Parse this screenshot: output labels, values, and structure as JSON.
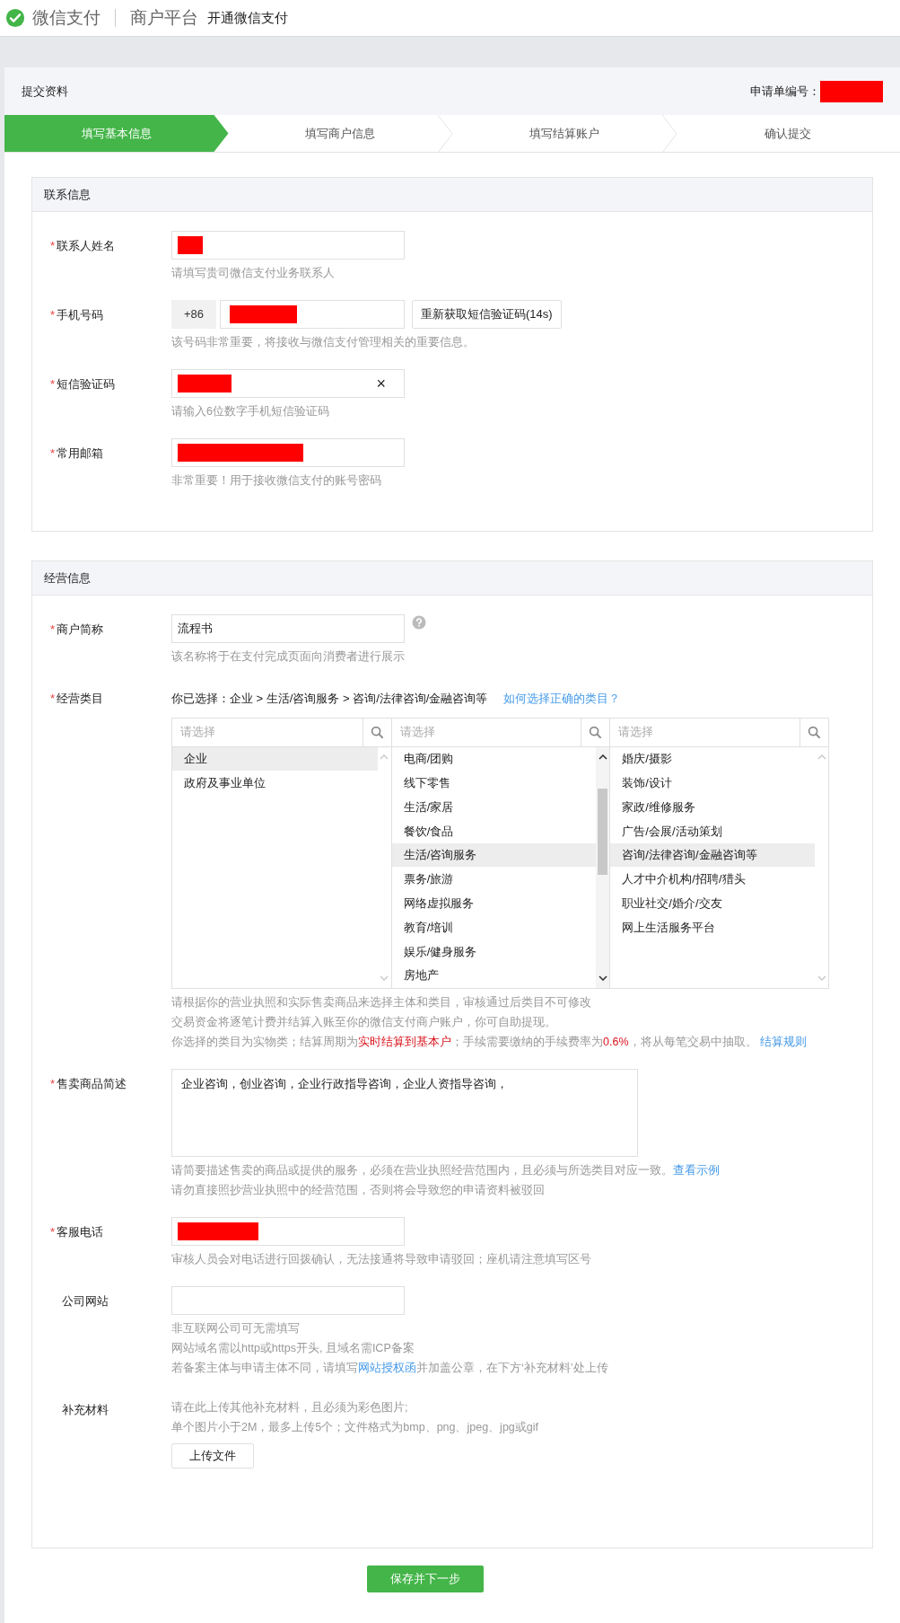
{
  "header": {
    "brand": "微信支付",
    "platform": "商户平台",
    "page_title": "开通微信支付"
  },
  "panel": {
    "title": "提交资料",
    "application_no_label": "申请单编号：",
    "application_no_redacted": true
  },
  "steps": [
    {
      "label": "填写基本信息",
      "selected": true
    },
    {
      "label": "填写商户信息",
      "selected": false
    },
    {
      "label": "填写结算账户",
      "selected": false
    },
    {
      "label": "确认提交",
      "selected": false
    }
  ],
  "sections": [
    {
      "title": "联系信息",
      "fields": [
        {
          "kind": "input",
          "required_mark": "*",
          "label": "联系人姓名",
          "redacted": true,
          "hints": [
            [
              {
                "text": "请填写贵司微信支付业务联系人"
              }
            ]
          ]
        },
        {
          "kind": "phone",
          "required_mark": "*",
          "label": "手机号码",
          "prefix": "+86",
          "redacted": true,
          "button": "重新获取短信验证码(14s)",
          "hints": [
            [
              {
                "text": "该号码非常重要，将接收与微信支付管理相关的重要信息。"
              }
            ]
          ]
        },
        {
          "kind": "input",
          "required_mark": "*",
          "label": "短信验证码",
          "redacted": true,
          "clear_icon": "×",
          "hints": [
            [
              {
                "text": "请输入6位数字手机短信验证码"
              }
            ]
          ]
        },
        {
          "kind": "input",
          "required_mark": "*",
          "label": "常用邮箱",
          "redacted": true,
          "hints": [
            [
              {
                "text": "非常重要！用于接收微信支付的账号密码"
              }
            ]
          ]
        }
      ]
    },
    {
      "title": "经营信息",
      "fields": [
        {
          "kind": "input",
          "required_mark": "*",
          "label": "商户简称",
          "value": "流程书",
          "help": true,
          "hints": [
            [
              {
                "text": "该名称将于在支付完成页面向消费者进行展示"
              }
            ]
          ]
        },
        {
          "kind": "category",
          "required_mark": "*",
          "label": "经营类目",
          "selection": "你已选择：企业 > 生活/咨询服务 > 咨询/法律咨询/金融咨询等",
          "link": "如何选择正确的类目？",
          "columns": [
            {
              "placeholder": "请选择",
              "scrollable": false,
              "items": [
                {
                  "label": "企业",
                  "selected": true
                },
                {
                  "label": "政府及事业单位",
                  "selected": false
                }
              ]
            },
            {
              "placeholder": "请选择",
              "scrollable": true,
              "items": [
                {
                  "label": "电商/团购",
                  "selected": false
                },
                {
                  "label": "线下零售",
                  "selected": false
                },
                {
                  "label": "生活/家居",
                  "selected": false
                },
                {
                  "label": "餐饮/食品",
                  "selected": false
                },
                {
                  "label": "生活/咨询服务",
                  "selected": true
                },
                {
                  "label": "票务/旅游",
                  "selected": false
                },
                {
                  "label": "网络虚拟服务",
                  "selected": false
                },
                {
                  "label": "教育/培训",
                  "selected": false
                },
                {
                  "label": "娱乐/健身服务",
                  "selected": false
                },
                {
                  "label": "房地产",
                  "selected": false
                }
              ]
            },
            {
              "placeholder": "请选择",
              "scrollable": false,
              "items": [
                {
                  "label": "婚庆/摄影",
                  "selected": false
                },
                {
                  "label": "装饰/设计",
                  "selected": false
                },
                {
                  "label": "家政/维修服务",
                  "selected": false
                },
                {
                  "label": "广告/会展/活动策划",
                  "selected": false
                },
                {
                  "label": "咨询/法律咨询/金融咨询等",
                  "selected": true
                },
                {
                  "label": "人才中介机构/招聘/猎头",
                  "selected": false
                },
                {
                  "label": "职业社交/婚介/交友",
                  "selected": false
                },
                {
                  "label": "网上生活服务平台",
                  "selected": false
                }
              ]
            }
          ],
          "hints": [
            [
              {
                "text": "请根据你的营业执照和实际售卖商品来选择主体和类目，审核通过后类目不可修改"
              }
            ],
            [
              {
                "text": "交易资金将逐笔计费并结算入账至你的微信支付商户账户，你可自助提现。"
              }
            ],
            [
              {
                "text": "你选择的类目为实物类；结算周期为"
              },
              {
                "text": "实时结算到基本户",
                "highlight": true
              },
              {
                "text": "；手续需要缴纳的手续费率为"
              },
              {
                "text": "0.6%",
                "highlight": true
              },
              {
                "text": "，将从每笔交易中抽取。 "
              },
              {
                "text": "结算规则",
                "link": true
              }
            ]
          ]
        },
        {
          "kind": "textarea",
          "required_mark": "*",
          "label": "售卖商品简述",
          "value": "企业咨询，创业咨询，企业行政指导咨询，企业人资指导咨询，",
          "hints": [
            [
              {
                "text": "请简要描述售卖的商品或提供的服务，必须在营业执照经营范围内，且必须与所选类目对应一致。"
              },
              {
                "text": "查看示例",
                "link": true
              }
            ],
            [
              {
                "text": "请勿直接照抄营业执照中的经营范围，否则将会导致您的申请资料被驳回"
              }
            ]
          ]
        },
        {
          "kind": "input",
          "required_mark": "*",
          "label": "客服电话",
          "redacted": true,
          "hints": [
            [
              {
                "text": "审核人员会对电话进行回拨确认，无法接通将导致申请驳回；座机请注意填写区号"
              }
            ]
          ]
        },
        {
          "kind": "input",
          "label": "公司网站",
          "hints": [
            [
              {
                "text": "非互联网公司可无需填写"
              }
            ],
            [
              {
                "text": "网站域名需以http或https开头, 且域名需ICP备案"
              }
            ],
            [
              {
                "text": "若备案主体与申请主体不同，请填写"
              },
              {
                "text": "网站授权函",
                "link": true
              },
              {
                "text": "并加盖公章，在下方‘补充材料’处上传"
              }
            ]
          ]
        },
        {
          "kind": "upload",
          "label": "补充材料",
          "button": "上传文件",
          "hints": [
            [
              {
                "text": "请在此上传其他补充材料，且必须为彩色图片;"
              }
            ],
            [
              {
                "text": "单个图片小于2M，最多上传5个；文件格式为bmp、png、jpeg、jpg或gif"
              }
            ]
          ]
        }
      ]
    }
  ],
  "save_button": "保存并下一步"
}
